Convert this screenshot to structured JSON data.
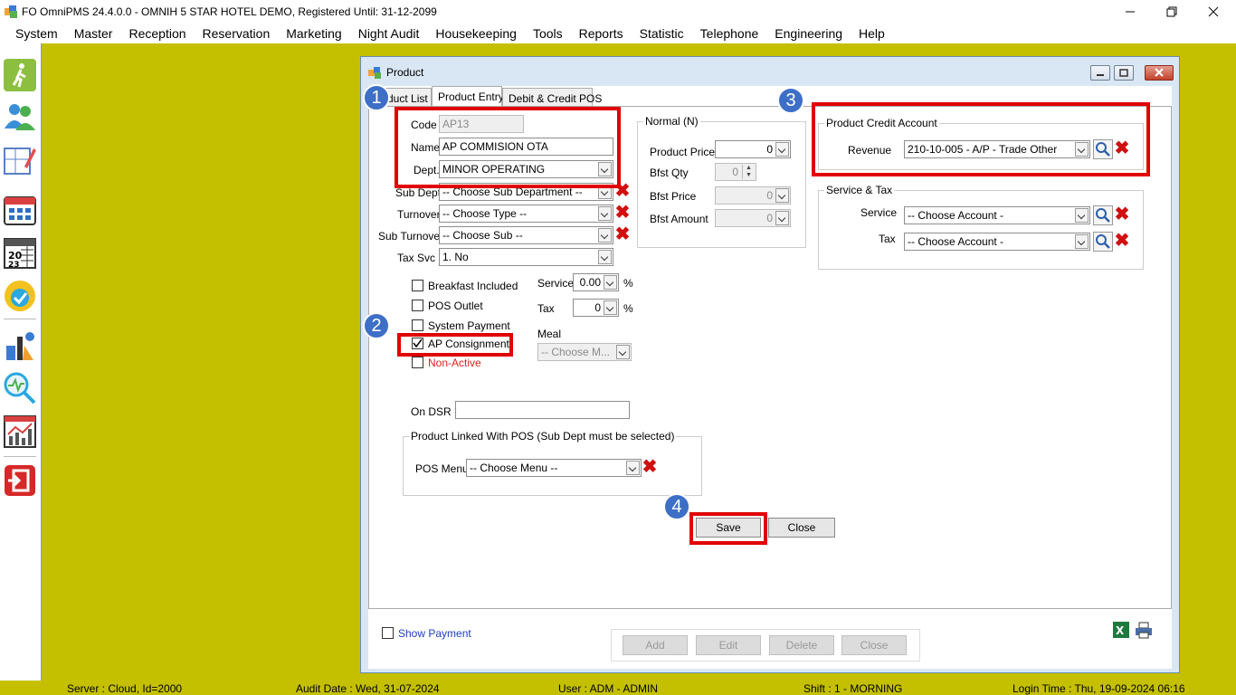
{
  "window_title": "FO OmniPMS 24.4.0.0 - OMNIH 5 STAR HOTEL DEMO, Registered Until: 31-12-2099",
  "menu": [
    "System",
    "Master",
    "Reception",
    "Reservation",
    "Marketing",
    "Night Audit",
    "Housekeeping",
    "Tools",
    "Reports",
    "Statistic",
    "Telephone",
    "Engineering",
    "Help"
  ],
  "status": {
    "server": "Server : Cloud, Id=2000",
    "audit": "Audit Date : Wed, 31-07-2024",
    "user": "User : ADM - ADMIN",
    "shift": "Shift : 1 - MORNING",
    "login": "Login Time : Thu, 19-09-2024 06:16"
  },
  "product_window": {
    "title": "Product",
    "tabs": [
      "duct List",
      "Product Entry",
      "Debit & Credit POS"
    ],
    "form": {
      "code_label": "Code",
      "code_value": "AP13",
      "name_label": "Name",
      "name_value": "AP COMMISION OTA",
      "dept_label": "Dept.",
      "dept_value": "MINOR OPERATING",
      "subdept_label": "Sub Dept",
      "subdept_value": "-- Choose Sub Department --",
      "turnover_label": "Turnover",
      "turnover_value": "-- Choose Type --",
      "subturnover_label": "Sub Turnover",
      "subturnover_value": "-- Choose Sub --",
      "taxsvc_label": "Tax Svc",
      "taxsvc_value": "1. No",
      "checkboxes": [
        {
          "label": "Breakfast Included",
          "checked": false
        },
        {
          "label": "POS Outlet",
          "checked": false
        },
        {
          "label": "System Payment",
          "checked": false
        },
        {
          "label": "AP Consignment",
          "checked": true
        },
        {
          "label": "Non-Active",
          "checked": false
        }
      ],
      "service_label": "Service",
      "service_value": "0.00",
      "pct": "%",
      "tax_label": "Tax",
      "tax_value": "0",
      "meal_label": "Meal",
      "meal_value": "-- Choose M...",
      "ondsr_label": "On DSR",
      "ondsr_value": "",
      "normal": {
        "title": "Normal (N)",
        "price_label": "Product Price",
        "price_value": "0",
        "bfqty_label": "Bfst Qty",
        "bfqty_value": "0",
        "bfprice_label": "Bfst Price",
        "bfprice_value": "0",
        "bfamount_label": "Bfst Amount",
        "bfamount_value": "0"
      },
      "credit": {
        "title": "Product Credit Account",
        "revenue_label": "Revenue",
        "revenue_value": "210-10-005 - A/P - Trade Other"
      },
      "svc_tax": {
        "title": "Service & Tax",
        "service_label": "Service",
        "service_value": "-- Choose Account -",
        "tax_label": "Tax",
        "tax_value": "-- Choose Account -"
      },
      "pos_link": {
        "title": "Product Linked With POS (Sub Dept must be selected)",
        "menu_label": "POS Menu",
        "menu_value": "-- Choose Menu --"
      },
      "save_label": "Save",
      "close_label": "Close"
    },
    "show_payment_label": "Show Payment",
    "bottom_buttons": [
      "Add",
      "Edit",
      "Delete",
      "Close"
    ],
    "badges": [
      "1",
      "2",
      "3",
      "4"
    ]
  },
  "colors": {
    "background": "#c4c000",
    "highlight": "#e00000",
    "badge": "#3e6fc7"
  }
}
